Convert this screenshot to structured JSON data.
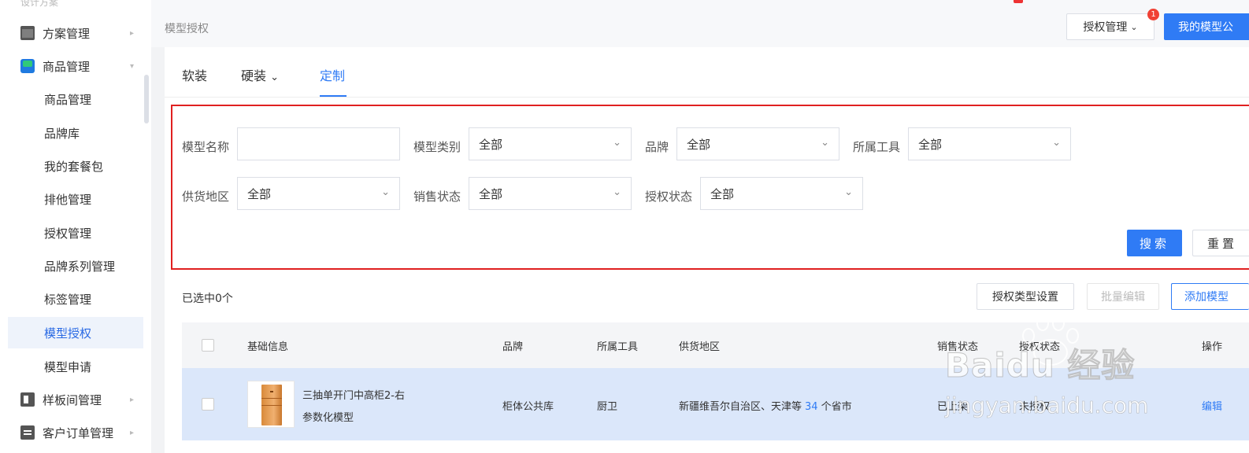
{
  "sidebar": {
    "cut_label": "设计方案",
    "items": [
      {
        "label": "方案管理",
        "type": "parent",
        "icon": "folder-icon"
      },
      {
        "label": "商品管理",
        "type": "parent",
        "icon": "shopping-bag-icon"
      },
      {
        "label": "商品管理",
        "type": "child"
      },
      {
        "label": "品牌库",
        "type": "child"
      },
      {
        "label": "我的套餐包",
        "type": "child"
      },
      {
        "label": "排他管理",
        "type": "child"
      },
      {
        "label": "授权管理",
        "type": "child"
      },
      {
        "label": "品牌系列管理",
        "type": "child"
      },
      {
        "label": "标签管理",
        "type": "child"
      },
      {
        "label": "模型授权",
        "type": "child",
        "active": true
      },
      {
        "label": "模型申请",
        "type": "child"
      },
      {
        "label": "样板间管理",
        "type": "parent",
        "icon": "room-icon"
      },
      {
        "label": "客户订单管理",
        "type": "parent",
        "icon": "clipboard-icon"
      }
    ]
  },
  "header": {
    "breadcrumb": "模型授权",
    "auth_menu_label": "授权管理",
    "notification_count": "1",
    "my_model_button": "我的模型公"
  },
  "tabs": [
    {
      "label": "软装"
    },
    {
      "label": "硬装",
      "has_dropdown": true
    },
    {
      "label": "定制",
      "active": true
    }
  ],
  "filters": {
    "model_name_label": "模型名称",
    "model_name_value": "",
    "model_type_label": "模型类别",
    "model_type_value": "全部",
    "brand_label": "品牌",
    "brand_value": "全部",
    "tool_label": "所属工具",
    "tool_value": "全部",
    "region_label": "供货地区",
    "region_value": "全部",
    "sale_status_label": "销售状态",
    "sale_status_value": "全部",
    "auth_status_label": "授权状态",
    "auth_status_value": "全部",
    "search_button": "搜索",
    "reset_button": "重置"
  },
  "toolbar": {
    "selected_text": "已选中0个",
    "auth_type_button": "授权类型设置",
    "batch_edit_button": "批量编辑",
    "add_model_button": "添加模型"
  },
  "table": {
    "headers": [
      "基础信息",
      "品牌",
      "所属工具",
      "供货地区",
      "销售状态",
      "授权状态",
      "操作"
    ],
    "rows": [
      {
        "name": "三抽单开门中高柜2-右",
        "model_type": "参数化模型",
        "brand": "柜体公共库",
        "tool": "厨卫",
        "region_prefix": "新疆维吾尔自治区、天津等",
        "region_count": "34",
        "region_suffix": "个省市",
        "sale_status": "已上架",
        "auth_status": "未授权",
        "action": "编辑"
      }
    ]
  },
  "watermark": {
    "main": "Baidu 经验",
    "url": "jingyan.baidu.com"
  }
}
